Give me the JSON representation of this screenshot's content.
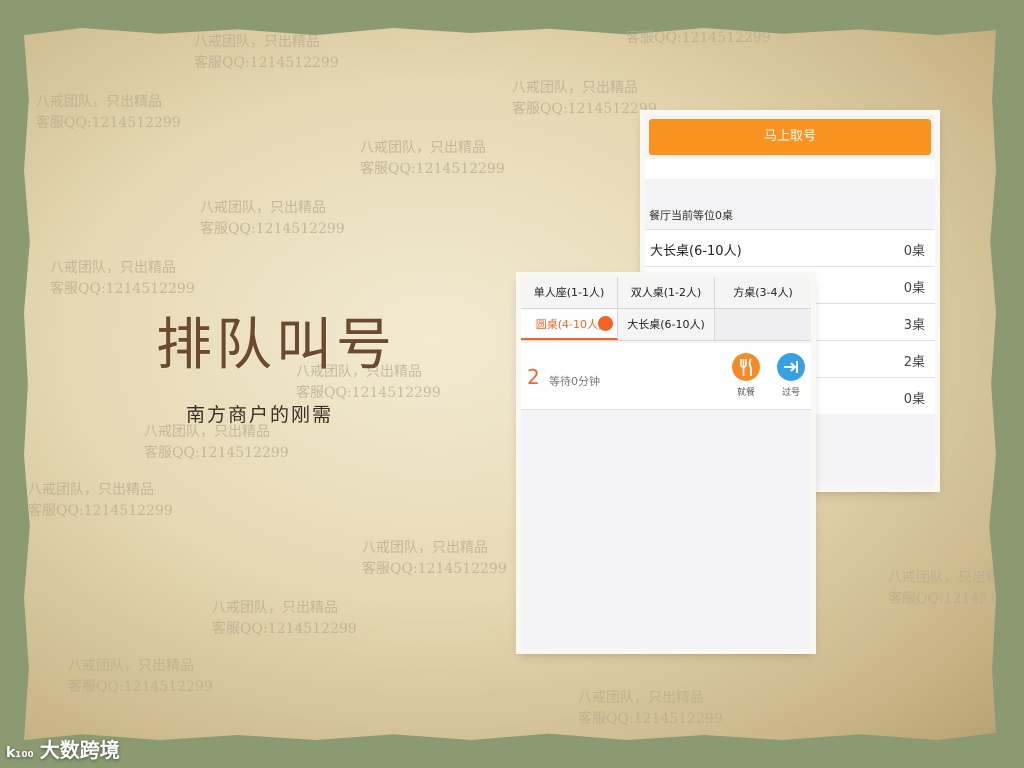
{
  "slide": {
    "title": "排队叫号",
    "subtitle": "南方商户的刚需",
    "watermark": {
      "line1": "八戒团队，只出精品",
      "line2": "客服QQ:1214512299"
    },
    "logo_mark": "k₁₀₀",
    "logo_text": "大数跨境"
  },
  "back_screen": {
    "take_number_button": "马上取号",
    "waiting_label": "餐厅当前等位0桌",
    "rows": [
      {
        "name": "大长桌(6-10人)",
        "count": "0桌"
      },
      {
        "name": "",
        "count": "0桌"
      },
      {
        "name": "",
        "count": "3桌"
      },
      {
        "name": "",
        "count": "2桌"
      },
      {
        "name": "",
        "count": "0桌"
      }
    ]
  },
  "front_screen": {
    "tabs_row1": [
      "单人座(1-1人)",
      "双人桌(1-2人)",
      "方桌(3-4人)"
    ],
    "tabs_row2": [
      "圆桌(4-10人)",
      "大长桌(6-10人)",
      ""
    ],
    "queue_item": {
      "number": "2",
      "wait": "等待0分钟",
      "dine_label": "就餐",
      "pass_label": "过号"
    }
  },
  "colors": {
    "accent_orange": "#f7931e",
    "active_tab": "#f26522",
    "pass_blue": "#3aa0e6",
    "title_brown": "#6b4a2e"
  }
}
